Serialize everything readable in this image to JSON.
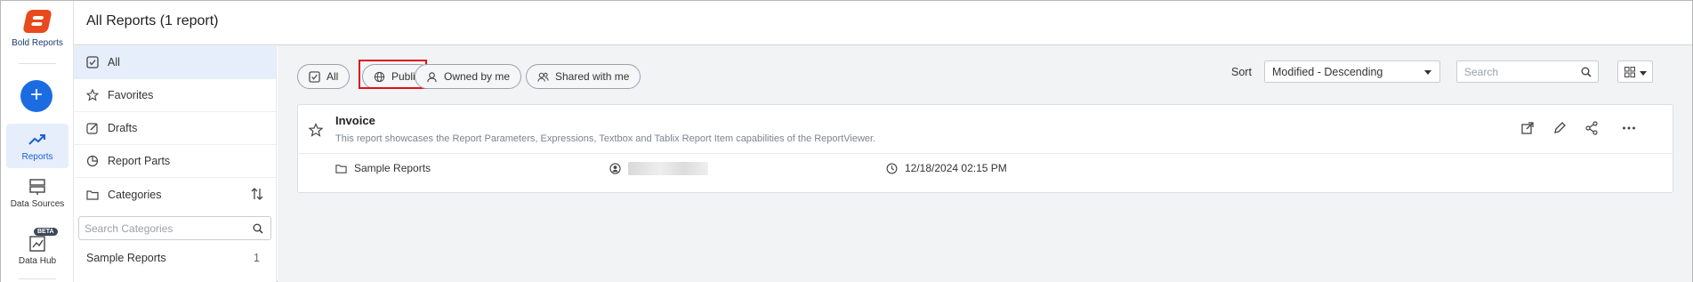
{
  "app": {
    "brand": "Bold Reports",
    "accent": "#1b6ce0",
    "brand_color": "#e8491d"
  },
  "rail": {
    "items": [
      {
        "label": "Reports",
        "icon": "trend-icon",
        "active": true
      },
      {
        "label": "Data Sources",
        "icon": "server-icon",
        "active": false
      },
      {
        "label": "Data Hub",
        "icon": "data-hub-icon",
        "badge": "BETA",
        "active": false
      }
    ]
  },
  "header": {
    "title": "All Reports (1 report)"
  },
  "categories_panel": {
    "items": [
      {
        "label": "All",
        "icon": "check-square-icon",
        "active": true
      },
      {
        "label": "Favorites",
        "icon": "star-icon"
      },
      {
        "label": "Drafts",
        "icon": "edit-square-icon"
      },
      {
        "label": "Report Parts",
        "icon": "pie-icon"
      },
      {
        "label": "Categories",
        "icon": "folder-icon"
      }
    ],
    "search_placeholder": "Search Categories",
    "list": [
      {
        "name": "Sample Reports",
        "count": "1"
      }
    ]
  },
  "filters": {
    "chips": [
      {
        "label": "All",
        "icon": "check-square-icon"
      },
      {
        "label": "Public",
        "icon": "globe-icon",
        "highlighted": true
      },
      {
        "label": "Owned by me",
        "icon": "user-icon"
      },
      {
        "label": "Shared with me",
        "icon": "users-icon"
      }
    ],
    "sort_label": "Sort",
    "sort_value": "Modified - Descending",
    "search_placeholder": "Search"
  },
  "report": {
    "name": "Invoice",
    "description": "This report showcases the Report Parameters, Expressions, Textbox and Tablix Report Item capabilities of the ReportViewer.",
    "category": "Sample Reports",
    "modified": "12/18/2024 02:15 PM"
  }
}
